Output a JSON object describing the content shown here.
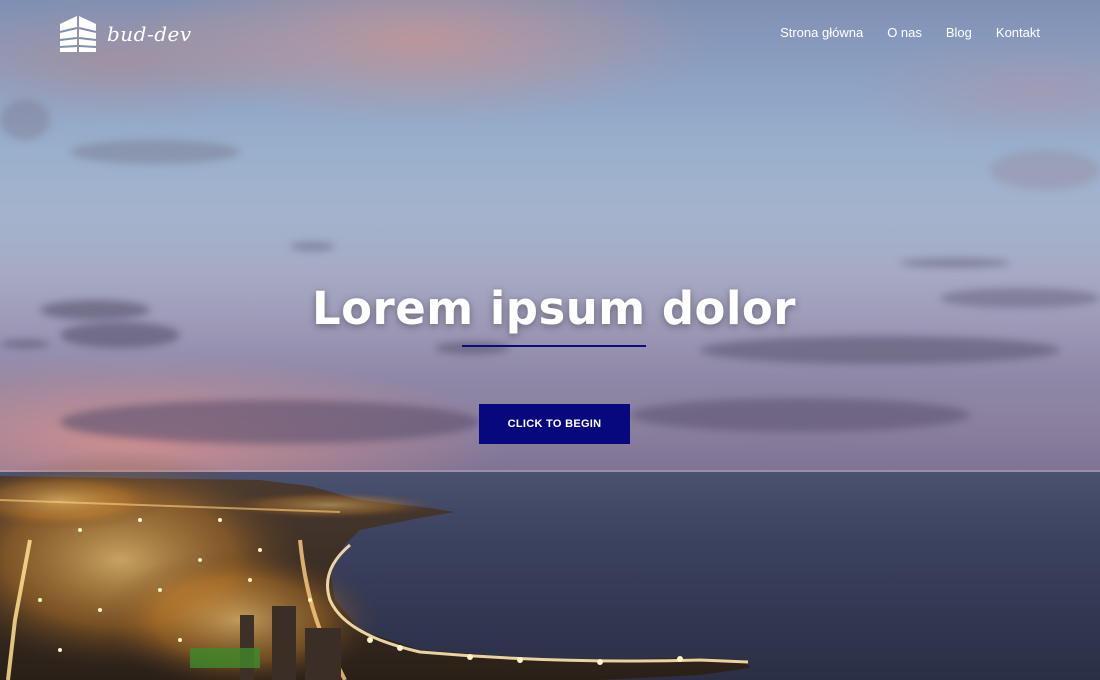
{
  "header": {
    "logo_text": "bud-dev",
    "logo_icon": "building-icon"
  },
  "nav": {
    "items": [
      {
        "label": "Strona główna"
      },
      {
        "label": "O nas"
      },
      {
        "label": "Blog"
      },
      {
        "label": "Kontakt"
      }
    ]
  },
  "hero": {
    "title": "Lorem ipsum dolor",
    "cta_label": "CLICK TO BEGIN",
    "underline_color": "#0d0d7a",
    "button_color": "#08087e"
  }
}
